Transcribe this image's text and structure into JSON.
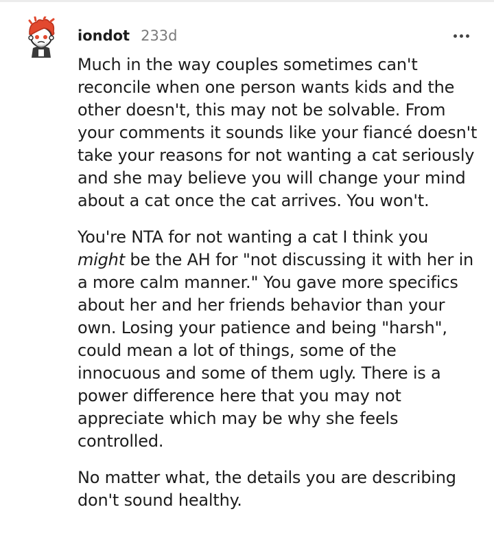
{
  "comment": {
    "username": "iondot",
    "timestamp": "233d",
    "more_icon": "more-horizontal-icon",
    "avatar_icon": "snoo-avatar-icon",
    "paragraphs": {
      "p1": "Much in the way couples sometimes can't reconcile when one person wants kids and the other doesn't, this may not be solvable. From your comments it sounds like your fiancé doesn't take your reasons for not wanting a cat seriously and she may believe you will change your mind about a cat once the cat arrives. You won't.",
      "p2_before": "You're NTA for not wanting a cat I think you ",
      "p2_italic": "might",
      "p2_after": " be the AH for \"not discussing it with her in a more calm manner.\" You gave more specifics about her and her friends behavior than your own. Losing your patience and being \"harsh\", could mean a lot of things, some of the innocuous and some of them ugly. There is a power difference here that you may not appreciate which may be why she feels controlled.",
      "p3": "No matter what, the details you are describing don't sound healthy."
    }
  },
  "colors": {
    "text": "#1c1c1c",
    "muted": "#7a7a7a",
    "avatar_hair": "#e2492f"
  }
}
